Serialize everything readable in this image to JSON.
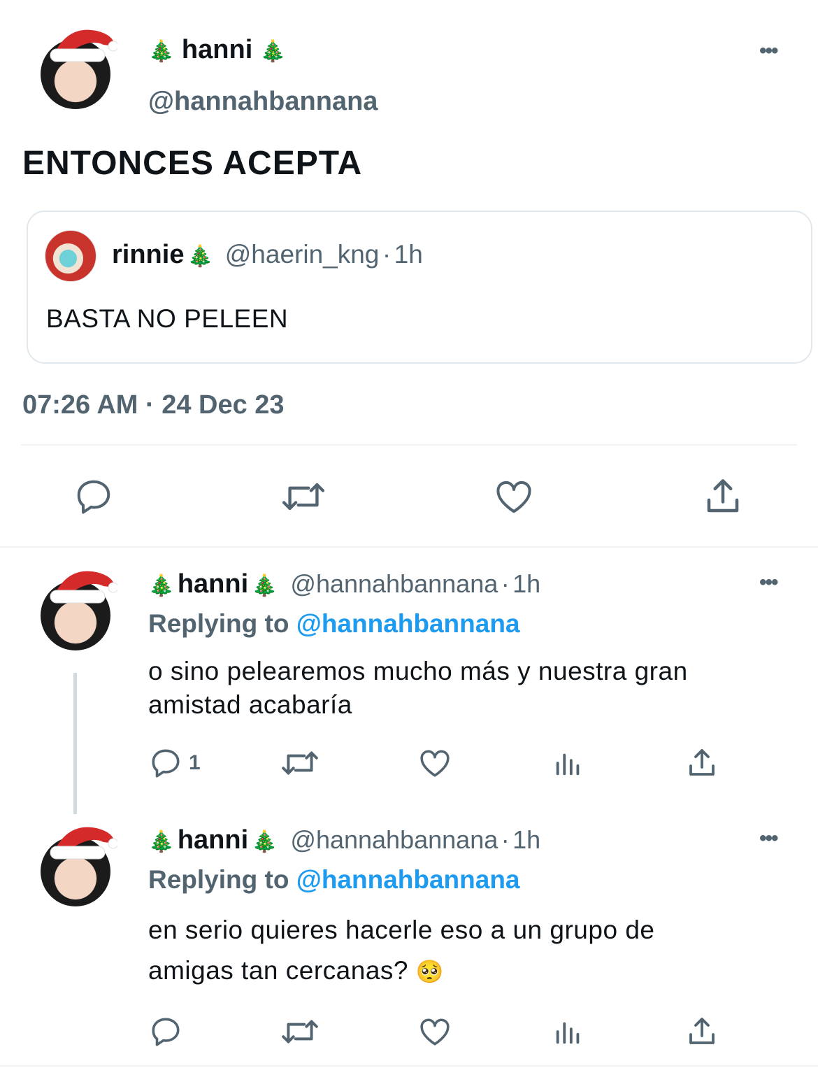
{
  "main_tweet": {
    "name": "hanni",
    "name_prefix_emoji": "🎄",
    "name_suffix_emoji": "🎄",
    "handle": "@hannahbannana",
    "text": "ENTONCES ACEPTA",
    "quoted": {
      "name": "rinnie",
      "name_emoji": "🎄",
      "handle": "@haerin_kng",
      "separator": "·",
      "time": "1h",
      "text": "BASTA NO PELEEN"
    },
    "timestamp": "07:26 AM · 24 Dec 23",
    "actions": [
      "reply-icon",
      "retweet-icon",
      "like-icon",
      "share-icon"
    ]
  },
  "replies": [
    {
      "name": "hanni",
      "name_prefix_emoji": "🎄",
      "name_suffix_emoji": "🎄",
      "handle": "@hannahbannana",
      "separator": "·",
      "time": "1h",
      "replying_label": "Replying to",
      "replying_handle": "@hannahbannana",
      "text_line1": "o sino pelearemos mucho más y nuestra gran",
      "text_line2": "amistad acabaría",
      "reply_count": "1"
    },
    {
      "name": "hanni",
      "name_prefix_emoji": "🎄",
      "name_suffix_emoji": "🎄",
      "handle": "@hannahbannana",
      "separator": "·",
      "time": "1h",
      "replying_label": "Replying to",
      "replying_handle": "@hannahbannana",
      "text_line1": "en serio quieres hacerle eso a un grupo de",
      "text_line2": "amigas tan cercanas?",
      "text_emoji": "🥺",
      "reply_count": ""
    }
  ],
  "more_label": "•••",
  "colors": {
    "text": "#0f1419",
    "secondary": "#536471",
    "mention": "#1d9bf0",
    "divider": "#eff3f4"
  }
}
